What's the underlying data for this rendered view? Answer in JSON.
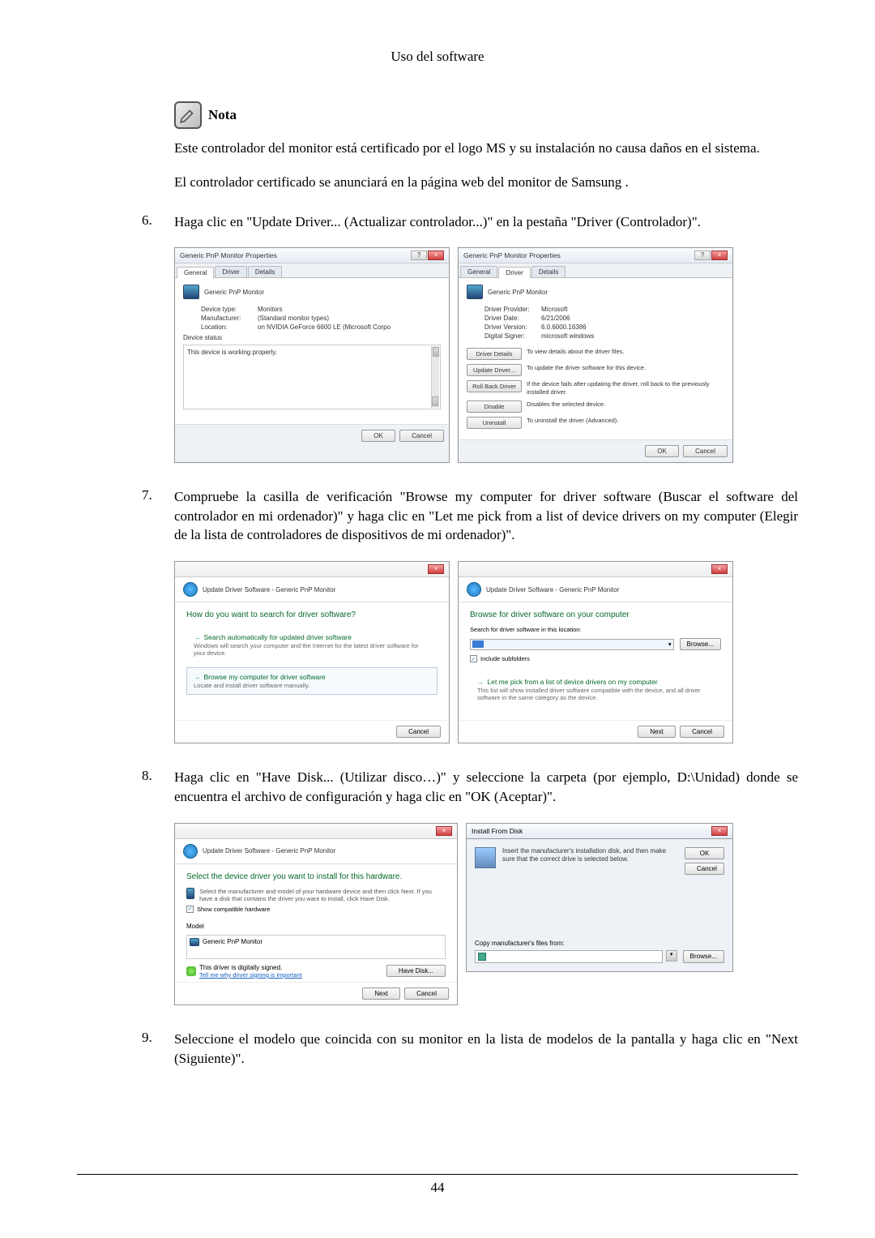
{
  "page": {
    "header": "Uso del software",
    "number": "44"
  },
  "note": {
    "label": "Nota",
    "p1": "Este controlador del monitor está certificado por el logo MS y su instalación no causa daños en el sistema.",
    "p2": "El controlador certificado se anunciará en la página web del monitor de Samsung ."
  },
  "steps": {
    "s6": {
      "num": "6.",
      "text": "Haga clic en \"Update Driver... (Actualizar controlador...)\" en la pestaña \"Driver (Controlador)\"."
    },
    "s7": {
      "num": "7.",
      "text": "Compruebe la casilla de verificación \"Browse my computer for driver software (Buscar el software del controlador en mi ordenador)\" y haga clic en \"Let me pick from a list of device drivers on my computer (Elegir de la lista de controladores de dispositivos de mi ordenador)\"."
    },
    "s8": {
      "num": "8.",
      "text": "Haga clic en \"Have Disk... (Utilizar disco…)\" y seleccione la carpeta (por ejemplo, D:\\Unidad) donde se encuentra el archivo de configuración y haga clic en \"OK (Aceptar)\"."
    },
    "s9": {
      "num": "9.",
      "text": "Seleccione el modelo que coincida con su monitor en la lista de modelos de la pantalla y haga clic en \"Next (Siguiente)\"."
    }
  },
  "dlg1": {
    "title": "Generic PnP Monitor Properties",
    "tabs": {
      "general": "General",
      "driver": "Driver",
      "details": "Details"
    },
    "device": "Generic PnP Monitor",
    "rows": {
      "type_l": "Device type:",
      "type_v": "Monitors",
      "mfr_l": "Manufacturer:",
      "mfr_v": "(Standard monitor types)",
      "loc_l": "Location:",
      "loc_v": "on NVIDIA GeForce 6600 LE (Microsoft Corpo"
    },
    "status_l": "Device status",
    "status_v": "This device is working properly.",
    "ok": "OK",
    "cancel": "Cancel"
  },
  "dlg2": {
    "title": "Generic PnP Monitor Properties",
    "rows": {
      "prov_l": "Driver Provider:",
      "prov_v": "Microsoft",
      "date_l": "Driver Date:",
      "date_v": "6/21/2006",
      "ver_l": "Driver Version:",
      "ver_v": "6.0.6000.16386",
      "sign_l": "Digital Signer:",
      "sign_v": "microsoft windows"
    },
    "btns": {
      "details": "Driver Details",
      "details_d": "To view details about the driver files.",
      "update": "Update Driver...",
      "update_d": "To update the driver software for this device.",
      "rollback": "Roll Back Driver",
      "rollback_d": "If the device fails after updating the driver, roll back to the previously installed driver.",
      "disable": "Disable",
      "disable_d": "Disables the selected device.",
      "uninstall": "Uninstall",
      "uninstall_d": "To uninstall the driver (Advanced)."
    },
    "ok": "OK",
    "cancel": "Cancel"
  },
  "wiz1": {
    "path": "Update Driver Software - Generic PnP Monitor",
    "heading": "How do you want to search for driver software?",
    "opt1_t": "Search automatically for updated driver software",
    "opt1_s": "Windows will search your computer and the Internet for the latest driver software for your device.",
    "opt2_t": "Browse my computer for driver software",
    "opt2_s": "Locate and install driver software manually.",
    "cancel": "Cancel"
  },
  "wiz2": {
    "path": "Update Driver Software - Generic PnP Monitor",
    "heading": "Browse for driver software on your computer",
    "search_l": "Search for driver software in this location:",
    "browse": "Browse...",
    "include": "Include subfolders",
    "opt_t": "Let me pick from a list of device drivers on my computer",
    "opt_s": "This list will show installed driver software compatible with the device, and all driver software in the same category as the device.",
    "next": "Next",
    "cancel": "Cancel"
  },
  "wiz3": {
    "path": "Update Driver Software - Generic PnP Monitor",
    "heading": "Select the device driver you want to install for this hardware.",
    "sub": "Select the manufacturer and model of your hardware device and then click Next. If you have a disk that contains the driver you want to install, click Have Disk.",
    "compat": "Show compatible hardware",
    "model_h": "Model",
    "model_v": "Generic PnP Monitor",
    "signed": "This driver is digitally signed.",
    "tell": "Tell me why driver signing is important",
    "have_disk": "Have Disk...",
    "next": "Next",
    "cancel": "Cancel"
  },
  "install": {
    "title": "Install From Disk",
    "text": "Insert the manufacturer's installation disk, and then make sure that the correct drive is selected below.",
    "ok": "OK",
    "cancel": "Cancel",
    "copy_l": "Copy manufacturer's files from:",
    "browse": "Browse..."
  }
}
